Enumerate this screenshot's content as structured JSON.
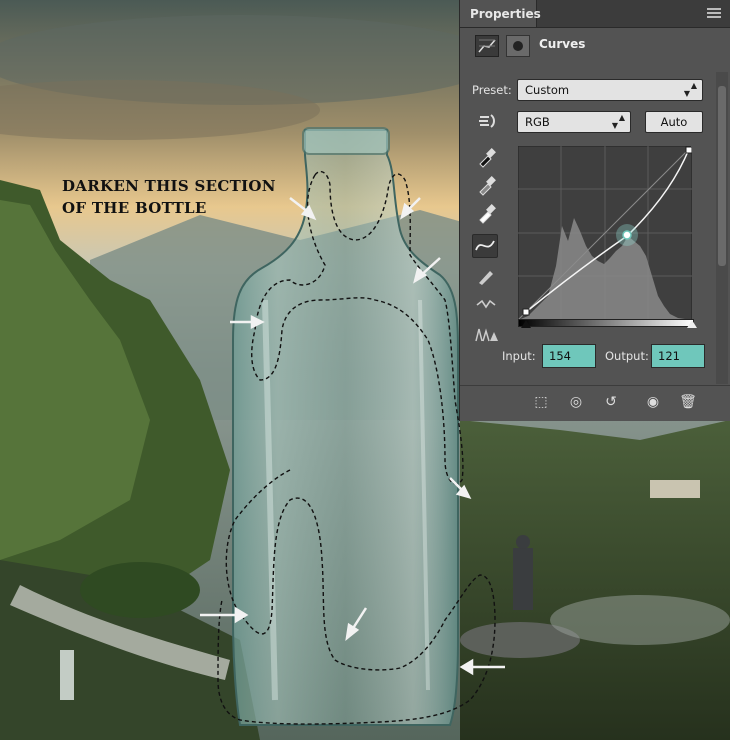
{
  "annotation": {
    "line1": "DARKEN THIS SECTION",
    "line2": "OF THE BOTTLE"
  },
  "panel": {
    "tab_label": "Properties",
    "title": "Curves",
    "preset_label": "Preset:",
    "preset_value": "Custom",
    "channel_value": "RGB",
    "auto_label": "Auto",
    "input_label": "Input:",
    "input_value": "154",
    "output_label": "Output:",
    "output_value": "121"
  },
  "colors": {
    "panel_bg": "#535353",
    "field_accent": "#6fc7bb",
    "selection": "#000000"
  },
  "icons": [
    "adjustment-icon",
    "mask-icon",
    "hand-target-icon",
    "eyedropper-black-icon",
    "eyedropper-gray-icon",
    "eyedropper-white-icon",
    "curve-point-icon",
    "pencil-icon",
    "smooth-icon",
    "clipping-warning-icon",
    "clip-to-layer-icon",
    "visibility-toggle-icon",
    "reset-icon",
    "eye-icon",
    "trash-icon",
    "panel-menu-icon"
  ]
}
